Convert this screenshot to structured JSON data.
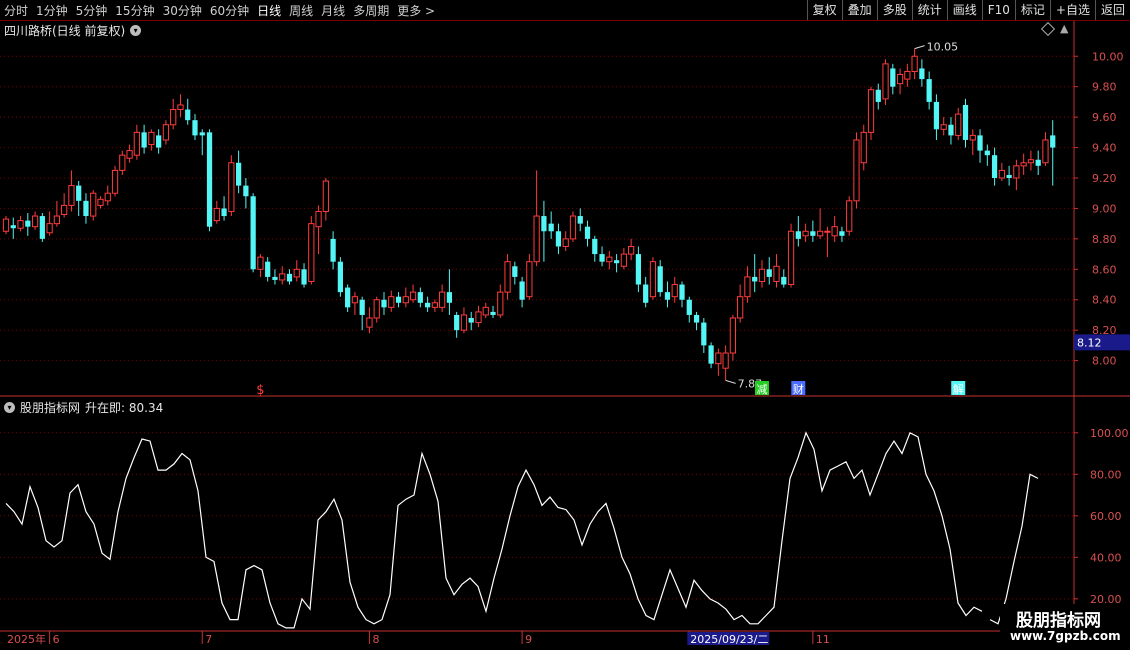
{
  "toolbar": {
    "periods": [
      "分时",
      "1分钟",
      "5分钟",
      "15分钟",
      "30分钟",
      "60分钟",
      "日线",
      "周线",
      "月线",
      "多周期",
      "更多 >"
    ],
    "active_index": 6,
    "right_buttons": [
      "复权",
      "叠加",
      "多股",
      "统计",
      "画线",
      "F10",
      "标记",
      "+自选",
      "返回"
    ]
  },
  "main_title": "四川路桥(日线 前复权)",
  "indicator_title": "股朋指标网",
  "indicator_label": "升在即: 80.34",
  "watermark": {
    "line1": "股朋指标网",
    "line2": "www.7gpzb.com"
  },
  "colors": {
    "up": "#ff3c3c",
    "down": "#53f5f5",
    "grid": "#7a0000",
    "axis": "#c83232",
    "line": "#ffffff"
  },
  "chart_data": [
    {
      "type": "candlestick",
      "ylim": [
        7.82,
        10.12
      ],
      "yticks": [
        "8.00",
        "8.20",
        "8.40",
        "8.60",
        "8.80",
        "9.00",
        "9.20",
        "9.40",
        "9.60",
        "9.80",
        "10.00"
      ],
      "current_price_label": "8.12",
      "max_label": "10.05",
      "min_label": "7.87",
      "events": [
        {
          "index": 35,
          "text": "$",
          "color": "#ff3c3c"
        },
        {
          "index": 104,
          "text": "减",
          "color": "#22cc22"
        },
        {
          "index": 109,
          "text": "财",
          "color": "#4a6cff"
        },
        {
          "index": 131,
          "text": "解",
          "color": "#53f5f5"
        }
      ],
      "x_axis": [
        {
          "index": 0,
          "label": "2025年"
        },
        {
          "index": 6,
          "label": "6"
        },
        {
          "index": 27,
          "label": "7"
        },
        {
          "index": 50,
          "label": "8"
        },
        {
          "index": 71,
          "label": "9"
        },
        {
          "index": 94,
          "label": "2025/09/23/二",
          "highlight": true
        },
        {
          "index": 111,
          "label": "11"
        }
      ],
      "series": [
        [
          8.85,
          8.93,
          8.83,
          8.95
        ],
        [
          8.89,
          8.87,
          8.8,
          8.94
        ],
        [
          8.87,
          8.92,
          8.85,
          8.95
        ],
        [
          8.92,
          8.88,
          8.82,
          8.97
        ],
        [
          8.88,
          8.95,
          8.86,
          8.98
        ],
        [
          8.95,
          8.8,
          8.78,
          8.97
        ],
        [
          8.84,
          8.9,
          8.82,
          8.98
        ],
        [
          8.9,
          8.95,
          8.88,
          9.05
        ],
        [
          8.96,
          9.02,
          8.94,
          9.1
        ],
        [
          9.02,
          9.15,
          8.98,
          9.25
        ],
        [
          9.15,
          9.05,
          8.95,
          9.18
        ],
        [
          9.05,
          8.95,
          8.9,
          9.1
        ],
        [
          8.95,
          9.1,
          8.92,
          9.12
        ],
        [
          9.02,
          9.06,
          9.0,
          9.08
        ],
        [
          9.05,
          9.1,
          9.02,
          9.15
        ],
        [
          9.1,
          9.25,
          9.08,
          9.28
        ],
        [
          9.25,
          9.35,
          9.22,
          9.38
        ],
        [
          9.33,
          9.38,
          9.3,
          9.42
        ],
        [
          9.35,
          9.5,
          9.32,
          9.55
        ],
        [
          9.5,
          9.4,
          9.36,
          9.55
        ],
        [
          9.42,
          9.5,
          9.38,
          9.52
        ],
        [
          9.48,
          9.4,
          9.36,
          9.52
        ],
        [
          9.45,
          9.55,
          9.42,
          9.58
        ],
        [
          9.55,
          9.65,
          9.52,
          9.72
        ],
        [
          9.65,
          9.68,
          9.6,
          9.75
        ],
        [
          9.65,
          9.58,
          9.55,
          9.72
        ],
        [
          9.58,
          9.48,
          9.45,
          9.62
        ],
        [
          9.5,
          9.48,
          9.35,
          9.52
        ],
        [
          9.5,
          8.88,
          8.85,
          9.52
        ],
        [
          8.92,
          9.0,
          8.9,
          9.05
        ],
        [
          9.0,
          8.95,
          8.92,
          9.08
        ],
        [
          8.98,
          9.3,
          8.95,
          9.35
        ],
        [
          9.3,
          9.15,
          9.1,
          9.38
        ],
        [
          9.15,
          9.08,
          9.0,
          9.2
        ],
        [
          9.08,
          8.6,
          8.58,
          9.1
        ],
        [
          8.6,
          8.68,
          8.55,
          8.7
        ],
        [
          8.65,
          8.55,
          8.52,
          8.68
        ],
        [
          8.55,
          8.53,
          8.5,
          8.6
        ],
        [
          8.53,
          8.57,
          8.5,
          8.62
        ],
        [
          8.57,
          8.52,
          8.5,
          8.6
        ],
        [
          8.55,
          8.6,
          8.52,
          8.66
        ],
        [
          8.6,
          8.5,
          8.48,
          8.64
        ],
        [
          8.52,
          8.9,
          8.5,
          8.95
        ],
        [
          8.88,
          8.98,
          8.7,
          9.02
        ],
        [
          8.98,
          9.18,
          8.92,
          9.2
        ],
        [
          8.8,
          8.65,
          8.6,
          8.85
        ],
        [
          8.65,
          8.45,
          8.42,
          8.68
        ],
        [
          8.48,
          8.35,
          8.32,
          8.5
        ],
        [
          8.38,
          8.42,
          8.3,
          8.45
        ],
        [
          8.4,
          8.3,
          8.2,
          8.42
        ],
        [
          8.22,
          8.28,
          8.18,
          8.35
        ],
        [
          8.28,
          8.4,
          8.25,
          8.42
        ],
        [
          8.4,
          8.35,
          8.3,
          8.45
        ],
        [
          8.35,
          8.42,
          8.32,
          8.46
        ],
        [
          8.42,
          8.38,
          8.35,
          8.45
        ],
        [
          8.38,
          8.42,
          8.35,
          8.48
        ],
        [
          8.4,
          8.45,
          8.38,
          8.5
        ],
        [
          8.45,
          8.38,
          8.35,
          8.48
        ],
        [
          8.38,
          8.35,
          8.32,
          8.42
        ],
        [
          8.35,
          8.38,
          8.32,
          8.4
        ],
        [
          8.35,
          8.45,
          8.32,
          8.5
        ],
        [
          8.45,
          8.38,
          8.3,
          8.6
        ],
        [
          8.3,
          8.2,
          8.15,
          8.32
        ],
        [
          8.2,
          8.3,
          8.18,
          8.35
        ],
        [
          8.28,
          8.25,
          8.2,
          8.32
        ],
        [
          8.25,
          8.32,
          8.22,
          8.36
        ],
        [
          8.3,
          8.35,
          8.28,
          8.38
        ],
        [
          8.32,
          8.3,
          8.28,
          8.36
        ],
        [
          8.3,
          8.45,
          8.28,
          8.5
        ],
        [
          8.45,
          8.65,
          8.4,
          8.7
        ],
        [
          8.62,
          8.55,
          8.5,
          8.65
        ],
        [
          8.52,
          8.4,
          8.35,
          8.55
        ],
        [
          8.42,
          8.65,
          8.4,
          8.7
        ],
        [
          8.65,
          8.95,
          8.62,
          9.25
        ],
        [
          8.95,
          8.85,
          8.65,
          9.05
        ],
        [
          8.9,
          8.85,
          8.8,
          8.98
        ],
        [
          8.85,
          8.75,
          8.7,
          8.9
        ],
        [
          8.75,
          8.8,
          8.72,
          8.85
        ],
        [
          8.8,
          8.95,
          8.78,
          8.98
        ],
        [
          8.95,
          8.9,
          8.85,
          9.0
        ],
        [
          8.88,
          8.8,
          8.75,
          8.92
        ],
        [
          8.8,
          8.7,
          8.65,
          8.82
        ],
        [
          8.7,
          8.65,
          8.62,
          8.75
        ],
        [
          8.65,
          8.68,
          8.6,
          8.72
        ],
        [
          8.66,
          8.64,
          8.58,
          8.7
        ],
        [
          8.62,
          8.7,
          8.6,
          8.74
        ],
        [
          8.7,
          8.75,
          8.66,
          8.8
        ],
        [
          8.7,
          8.5,
          8.45,
          8.75
        ],
        [
          8.5,
          8.38,
          8.35,
          8.55
        ],
        [
          8.42,
          8.65,
          8.4,
          8.68
        ],
        [
          8.62,
          8.45,
          8.42,
          8.66
        ],
        [
          8.45,
          8.4,
          8.35,
          8.52
        ],
        [
          8.42,
          8.5,
          8.38,
          8.55
        ],
        [
          8.5,
          8.4,
          8.35,
          8.52
        ],
        [
          8.4,
          8.3,
          8.25,
          8.42
        ],
        [
          8.3,
          8.25,
          8.2,
          8.32
        ],
        [
          8.25,
          8.1,
          8.05,
          8.28
        ],
        [
          8.1,
          7.98,
          7.95,
          8.12
        ],
        [
          7.98,
          8.05,
          7.9,
          8.08
        ],
        [
          7.95,
          8.05,
          7.87,
          8.1
        ],
        [
          8.05,
          8.28,
          8.0,
          8.3
        ],
        [
          8.28,
          8.42,
          8.25,
          8.5
        ],
        [
          8.42,
          8.55,
          8.38,
          8.62
        ],
        [
          8.55,
          8.52,
          8.45,
          8.7
        ],
        [
          8.52,
          8.6,
          8.48,
          8.66
        ],
        [
          8.6,
          8.55,
          8.5,
          8.68
        ],
        [
          8.52,
          8.62,
          8.48,
          8.7
        ],
        [
          8.55,
          8.5,
          8.48,
          8.6
        ],
        [
          8.5,
          8.85,
          8.48,
          8.9
        ],
        [
          8.85,
          8.8,
          8.75,
          8.95
        ],
        [
          8.82,
          8.85,
          8.78,
          8.9
        ],
        [
          8.85,
          8.82,
          8.78,
          8.92
        ],
        [
          8.82,
          8.85,
          8.8,
          9.0
        ],
        [
          8.85,
          8.85,
          8.68,
          8.88
        ],
        [
          8.82,
          8.88,
          8.78,
          8.95
        ],
        [
          8.85,
          8.82,
          8.78,
          8.88
        ],
        [
          8.85,
          9.05,
          8.82,
          9.08
        ],
        [
          9.05,
          9.45,
          9.0,
          9.5
        ],
        [
          9.3,
          9.5,
          9.25,
          9.55
        ],
        [
          9.5,
          9.78,
          9.45,
          9.8
        ],
        [
          9.78,
          9.7,
          9.65,
          9.82
        ],
        [
          9.72,
          9.95,
          9.68,
          9.98
        ],
        [
          9.92,
          9.8,
          9.75,
          9.95
        ],
        [
          9.82,
          9.88,
          9.75,
          9.92
        ],
        [
          9.85,
          9.9,
          9.8,
          9.95
        ],
        [
          9.9,
          10.0,
          9.85,
          10.05
        ],
        [
          9.92,
          9.85,
          9.8,
          9.98
        ],
        [
          9.85,
          9.7,
          9.65,
          9.9
        ],
        [
          9.7,
          9.52,
          9.45,
          9.75
        ],
        [
          9.52,
          9.55,
          9.48,
          9.6
        ],
        [
          9.55,
          9.48,
          9.42,
          9.6
        ],
        [
          9.48,
          9.62,
          9.45,
          9.66
        ],
        [
          9.68,
          9.45,
          9.4,
          9.72
        ],
        [
          9.45,
          9.48,
          9.35,
          9.52
        ],
        [
          9.48,
          9.38,
          9.3,
          9.52
        ],
        [
          9.38,
          9.35,
          9.28,
          9.42
        ],
        [
          9.35,
          9.2,
          9.15,
          9.4
        ],
        [
          9.2,
          9.25,
          9.18,
          9.3
        ],
        [
          9.22,
          9.2,
          9.15,
          9.28
        ],
        [
          9.2,
          9.28,
          9.12,
          9.32
        ],
        [
          9.28,
          9.3,
          9.22,
          9.36
        ],
        [
          9.3,
          9.32,
          9.25,
          9.38
        ],
        [
          9.32,
          9.28,
          9.22,
          9.38
        ],
        [
          9.3,
          9.45,
          9.28,
          9.5
        ],
        [
          9.48,
          9.4,
          9.15,
          9.58
        ]
      ]
    },
    {
      "type": "line",
      "name": "升在即",
      "ylim": [
        5,
        110
      ],
      "yticks": [
        "20.00",
        "40.00",
        "60.00",
        "80.00",
        "100.00"
      ],
      "values": [
        66,
        62,
        56,
        74,
        64,
        48,
        45,
        48,
        71,
        75,
        62,
        56,
        42,
        39,
        62,
        78,
        88,
        97,
        96,
        82,
        82,
        85,
        90,
        87,
        72,
        40,
        38,
        18,
        10,
        10,
        34,
        36,
        34,
        18,
        8,
        6,
        6,
        20,
        15,
        58,
        62,
        68,
        58,
        28,
        16,
        10,
        8,
        10,
        22,
        65,
        68,
        70,
        90,
        80,
        67,
        30,
        22,
        27,
        30,
        26,
        14,
        30,
        44,
        60,
        74,
        82,
        75,
        65,
        69,
        64,
        63,
        58,
        46,
        56,
        62,
        66,
        54,
        40,
        32,
        20,
        12,
        10,
        22,
        34,
        25,
        16,
        29,
        24,
        20,
        18,
        15,
        10,
        12,
        8,
        8,
        12,
        16,
        48,
        78,
        88,
        100,
        92,
        72,
        82,
        84,
        86,
        78,
        82,
        70,
        80,
        90,
        96,
        90,
        100,
        98,
        80,
        72,
        60,
        44,
        18,
        12,
        16,
        14,
        10,
        8,
        20,
        38,
        55,
        80,
        78
      ],
      "gap_after_index": 122
    }
  ]
}
